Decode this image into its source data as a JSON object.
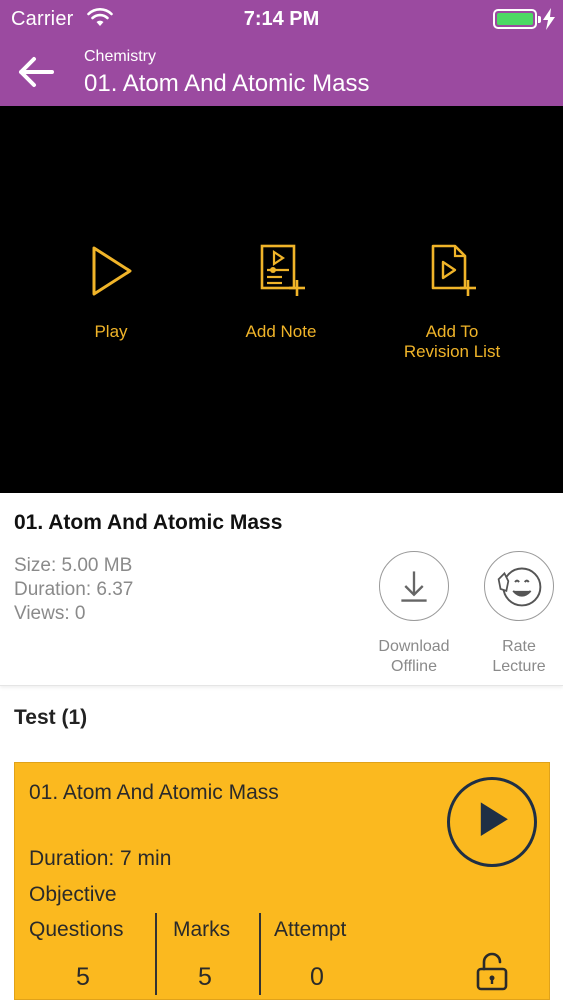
{
  "status_bar": {
    "carrier": "Carrier",
    "time": "7:14 PM",
    "battery_color": "#4cd964"
  },
  "header": {
    "subject": "Chemistry",
    "title": "01. Atom And Atomic Mass",
    "background_color": "#9b4aa0"
  },
  "video_actions": [
    {
      "label": "Play",
      "icon": "play-icon"
    },
    {
      "label": "Add Note",
      "icon": "add-note-icon"
    },
    {
      "label": "Add To Revision List",
      "icon": "add-revision-icon"
    }
  ],
  "accent_color": "#f0b429",
  "lecture": {
    "title": "01. Atom And Atomic Mass",
    "size": "Size: 5.00 MB",
    "duration": "Duration: 6.37",
    "views": "Views: 0",
    "download_label_1": "Download",
    "download_label_2": "Offline",
    "rate_label_1": "Rate",
    "rate_label_2": "Lecture"
  },
  "test_section": {
    "heading": "Test (1)",
    "card": {
      "title": "01. Atom And Atomic Mass",
      "duration": "Duration:  7 min",
      "type": "Objective",
      "questions_label": "Questions",
      "questions_value": "5",
      "marks_label": "Marks",
      "marks_value": "5",
      "attempt_label": "Attempt",
      "attempt_value": "0",
      "background_color": "#fbb91f"
    }
  }
}
